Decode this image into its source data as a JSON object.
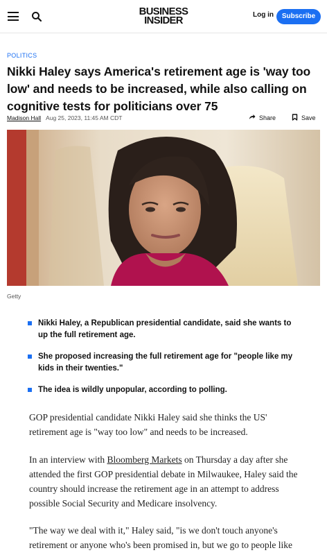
{
  "header": {
    "logo_line1": "BUSINESS",
    "logo_line2": "INSIDER",
    "login_label": "Log in",
    "subscribe_label": "Subscribe",
    "accent_color": "#1b6ff2"
  },
  "article": {
    "category": "POLITICS",
    "headline": "Nikki Haley says America's retirement age is 'way too low' and needs to be increased, while also calling on cognitive tests for politicians over 75",
    "author": "Madison Hall",
    "date": "Aug 25, 2023, 11:45 AM CDT",
    "share_label": "Share",
    "save_label": "Save",
    "image_caption": "Getty",
    "bullets": [
      "Nikki Haley, a Republican presidential candidate, said she wants to up the full retirement age.",
      "She proposed increasing the full retirement age for \"people like my kids in their twenties.\"",
      "The idea is wildly unpopular, according to polling."
    ],
    "p1": "GOP presidential candidate Nikki Haley said she thinks the US' retirement age is \"way too low\" and needs to be increased.",
    "p2_before": "In an interview with ",
    "p2_link": "Bloomberg Markets",
    "p2_after": " on Thursday a day after she attended the first GOP presidential debate in Milwaukee, Haley said the country should increase the retirement age in an attempt to address possible Social Security and Medicare insolvency.",
    "p3": "\"The way we deal with it,\" Haley said, \"is we don't touch anyone's retirement or anyone who's been promised in, but we go to people like"
  }
}
